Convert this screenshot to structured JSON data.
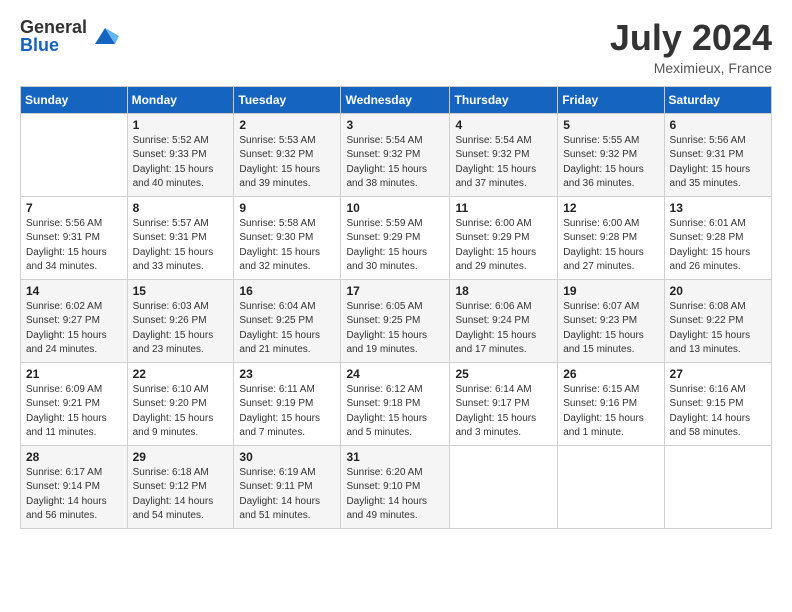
{
  "header": {
    "logo_general": "General",
    "logo_blue": "Blue",
    "month_year": "July 2024",
    "location": "Meximieux, France"
  },
  "days_of_week": [
    "Sunday",
    "Monday",
    "Tuesday",
    "Wednesday",
    "Thursday",
    "Friday",
    "Saturday"
  ],
  "weeks": [
    [
      {
        "day": "",
        "info": ""
      },
      {
        "day": "1",
        "info": "Sunrise: 5:52 AM\nSunset: 9:33 PM\nDaylight: 15 hours\nand 40 minutes."
      },
      {
        "day": "2",
        "info": "Sunrise: 5:53 AM\nSunset: 9:32 PM\nDaylight: 15 hours\nand 39 minutes."
      },
      {
        "day": "3",
        "info": "Sunrise: 5:54 AM\nSunset: 9:32 PM\nDaylight: 15 hours\nand 38 minutes."
      },
      {
        "day": "4",
        "info": "Sunrise: 5:54 AM\nSunset: 9:32 PM\nDaylight: 15 hours\nand 37 minutes."
      },
      {
        "day": "5",
        "info": "Sunrise: 5:55 AM\nSunset: 9:32 PM\nDaylight: 15 hours\nand 36 minutes."
      },
      {
        "day": "6",
        "info": "Sunrise: 5:56 AM\nSunset: 9:31 PM\nDaylight: 15 hours\nand 35 minutes."
      }
    ],
    [
      {
        "day": "7",
        "info": "Sunrise: 5:56 AM\nSunset: 9:31 PM\nDaylight: 15 hours\nand 34 minutes."
      },
      {
        "day": "8",
        "info": "Sunrise: 5:57 AM\nSunset: 9:31 PM\nDaylight: 15 hours\nand 33 minutes."
      },
      {
        "day": "9",
        "info": "Sunrise: 5:58 AM\nSunset: 9:30 PM\nDaylight: 15 hours\nand 32 minutes."
      },
      {
        "day": "10",
        "info": "Sunrise: 5:59 AM\nSunset: 9:29 PM\nDaylight: 15 hours\nand 30 minutes."
      },
      {
        "day": "11",
        "info": "Sunrise: 6:00 AM\nSunset: 9:29 PM\nDaylight: 15 hours\nand 29 minutes."
      },
      {
        "day": "12",
        "info": "Sunrise: 6:00 AM\nSunset: 9:28 PM\nDaylight: 15 hours\nand 27 minutes."
      },
      {
        "day": "13",
        "info": "Sunrise: 6:01 AM\nSunset: 9:28 PM\nDaylight: 15 hours\nand 26 minutes."
      }
    ],
    [
      {
        "day": "14",
        "info": "Sunrise: 6:02 AM\nSunset: 9:27 PM\nDaylight: 15 hours\nand 24 minutes."
      },
      {
        "day": "15",
        "info": "Sunrise: 6:03 AM\nSunset: 9:26 PM\nDaylight: 15 hours\nand 23 minutes."
      },
      {
        "day": "16",
        "info": "Sunrise: 6:04 AM\nSunset: 9:25 PM\nDaylight: 15 hours\nand 21 minutes."
      },
      {
        "day": "17",
        "info": "Sunrise: 6:05 AM\nSunset: 9:25 PM\nDaylight: 15 hours\nand 19 minutes."
      },
      {
        "day": "18",
        "info": "Sunrise: 6:06 AM\nSunset: 9:24 PM\nDaylight: 15 hours\nand 17 minutes."
      },
      {
        "day": "19",
        "info": "Sunrise: 6:07 AM\nSunset: 9:23 PM\nDaylight: 15 hours\nand 15 minutes."
      },
      {
        "day": "20",
        "info": "Sunrise: 6:08 AM\nSunset: 9:22 PM\nDaylight: 15 hours\nand 13 minutes."
      }
    ],
    [
      {
        "day": "21",
        "info": "Sunrise: 6:09 AM\nSunset: 9:21 PM\nDaylight: 15 hours\nand 11 minutes."
      },
      {
        "day": "22",
        "info": "Sunrise: 6:10 AM\nSunset: 9:20 PM\nDaylight: 15 hours\nand 9 minutes."
      },
      {
        "day": "23",
        "info": "Sunrise: 6:11 AM\nSunset: 9:19 PM\nDaylight: 15 hours\nand 7 minutes."
      },
      {
        "day": "24",
        "info": "Sunrise: 6:12 AM\nSunset: 9:18 PM\nDaylight: 15 hours\nand 5 minutes."
      },
      {
        "day": "25",
        "info": "Sunrise: 6:14 AM\nSunset: 9:17 PM\nDaylight: 15 hours\nand 3 minutes."
      },
      {
        "day": "26",
        "info": "Sunrise: 6:15 AM\nSunset: 9:16 PM\nDaylight: 15 hours\nand 1 minute."
      },
      {
        "day": "27",
        "info": "Sunrise: 6:16 AM\nSunset: 9:15 PM\nDaylight: 14 hours\nand 58 minutes."
      }
    ],
    [
      {
        "day": "28",
        "info": "Sunrise: 6:17 AM\nSunset: 9:14 PM\nDaylight: 14 hours\nand 56 minutes."
      },
      {
        "day": "29",
        "info": "Sunrise: 6:18 AM\nSunset: 9:12 PM\nDaylight: 14 hours\nand 54 minutes."
      },
      {
        "day": "30",
        "info": "Sunrise: 6:19 AM\nSunset: 9:11 PM\nDaylight: 14 hours\nand 51 minutes."
      },
      {
        "day": "31",
        "info": "Sunrise: 6:20 AM\nSunset: 9:10 PM\nDaylight: 14 hours\nand 49 minutes."
      },
      {
        "day": "",
        "info": ""
      },
      {
        "day": "",
        "info": ""
      },
      {
        "day": "",
        "info": ""
      }
    ]
  ]
}
